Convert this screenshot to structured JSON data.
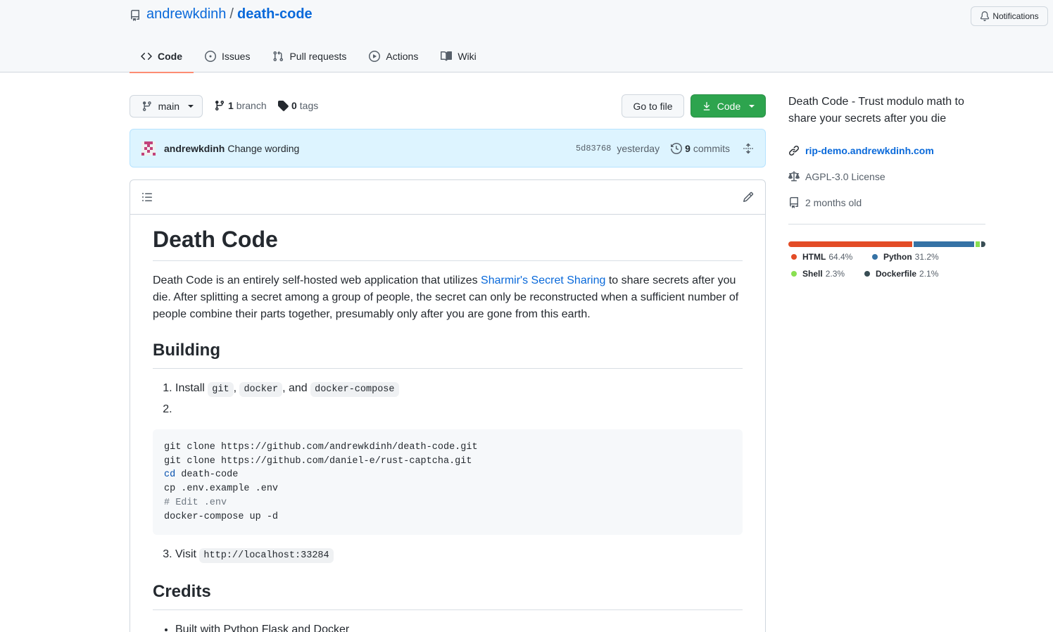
{
  "repo": {
    "owner": "andrewkdinh",
    "separator": "/",
    "name": "death-code"
  },
  "header": {
    "notifications_label": "Notifications"
  },
  "tabs": [
    {
      "label": "Code",
      "icon": "code-icon",
      "active": true
    },
    {
      "label": "Issues",
      "icon": "issue-icon",
      "active": false
    },
    {
      "label": "Pull requests",
      "icon": "pull-request-icon",
      "active": false
    },
    {
      "label": "Actions",
      "icon": "play-icon",
      "active": false
    },
    {
      "label": "Wiki",
      "icon": "book-icon",
      "active": false
    }
  ],
  "toolbar": {
    "branch": "main",
    "branch_count": "1",
    "branch_label": "branch",
    "tag_count": "0",
    "tag_label": "tags",
    "goto_file_label": "Go to file",
    "code_label": "Code"
  },
  "commit": {
    "author": "andrewkdinh",
    "message": "Change wording",
    "sha": "5d83768",
    "time": "yesterday",
    "commit_count": "9",
    "commit_label": "commits"
  },
  "readme": {
    "title": "Death Code",
    "intro_before_link": "Death Code is an entirely self-hosted web application that utilizes ",
    "intro_link": "Sharmir's Secret Sharing",
    "intro_after_link": " to share secrets after you die. After splitting a secret among a group of people, the secret can only be reconstructed when a sufficient number of people combine their parts together, presumably only after you are gone from this earth.",
    "building_heading": "Building",
    "step1_prefix": "Install ",
    "step1_code1": "git",
    "step1_sep1": ", ",
    "step1_code2": "docker",
    "step1_sep2": ", and ",
    "step1_code3": "docker-compose",
    "code_lines": {
      "l1": "git clone https://github.com/andrewkdinh/death-code.git",
      "l2": "git clone https://github.com/daniel-e/rust-captcha.git",
      "l3_kw": "cd",
      "l3_rest": " death-code",
      "l4": "cp .env.example .env",
      "l5": "# Edit .env",
      "l6": "docker-compose up -d"
    },
    "step3_prefix": "Visit ",
    "step3_code": "http://localhost:33284",
    "credits_heading": "Credits",
    "credits_item1": "Built with Python Flask and Docker"
  },
  "about": {
    "description": "Death Code - Trust modulo math to share your secrets after you die",
    "website": "rip-demo.andrewkdinh.com",
    "license": "AGPL-3.0 License",
    "age": "2 months old"
  },
  "languages": [
    {
      "name": "HTML",
      "percent": "64.4%",
      "value": 64.4,
      "color": "#e34c26"
    },
    {
      "name": "Python",
      "percent": "31.2%",
      "value": 31.2,
      "color": "#3572A5"
    },
    {
      "name": "Shell",
      "percent": "2.3%",
      "value": 2.3,
      "color": "#89e051"
    },
    {
      "name": "Dockerfile",
      "percent": "2.1%",
      "value": 2.1,
      "color": "#384d54"
    }
  ]
}
